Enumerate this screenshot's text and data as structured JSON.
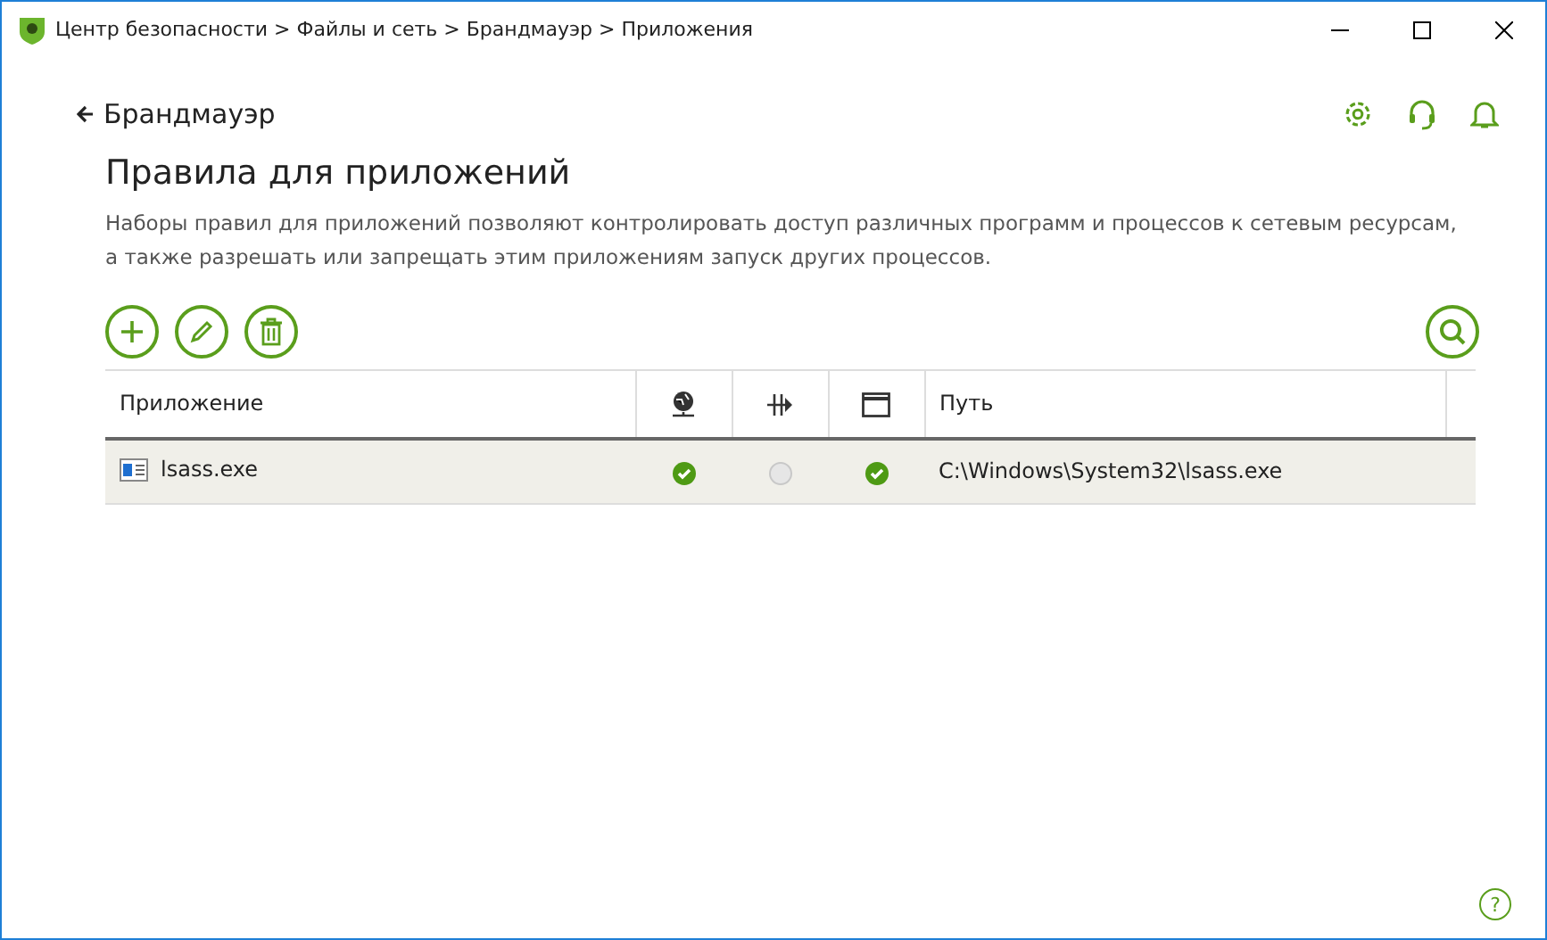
{
  "window": {
    "title": "Центр безопасности > Файлы и сеть > Брандмауэр > Приложения"
  },
  "back_link": "Брандмауэр",
  "heading": "Правила для приложений",
  "description": "Наборы правил для приложений позволяют контролировать доступ различных программ и процессов к сетевым ресурсам, а также разрешать или запрещать этим приложениям запуск других процессов.",
  "table": {
    "columns": {
      "application": "Приложение",
      "path": "Путь"
    },
    "rows": [
      {
        "name": "lsass.exe",
        "path": "C:\\Windows\\System32\\lsass.exe",
        "selected": true,
        "rules": [
          {
            "on": true
          },
          {
            "on": false
          },
          {
            "on": true
          }
        ]
      }
    ]
  },
  "help": "?"
}
